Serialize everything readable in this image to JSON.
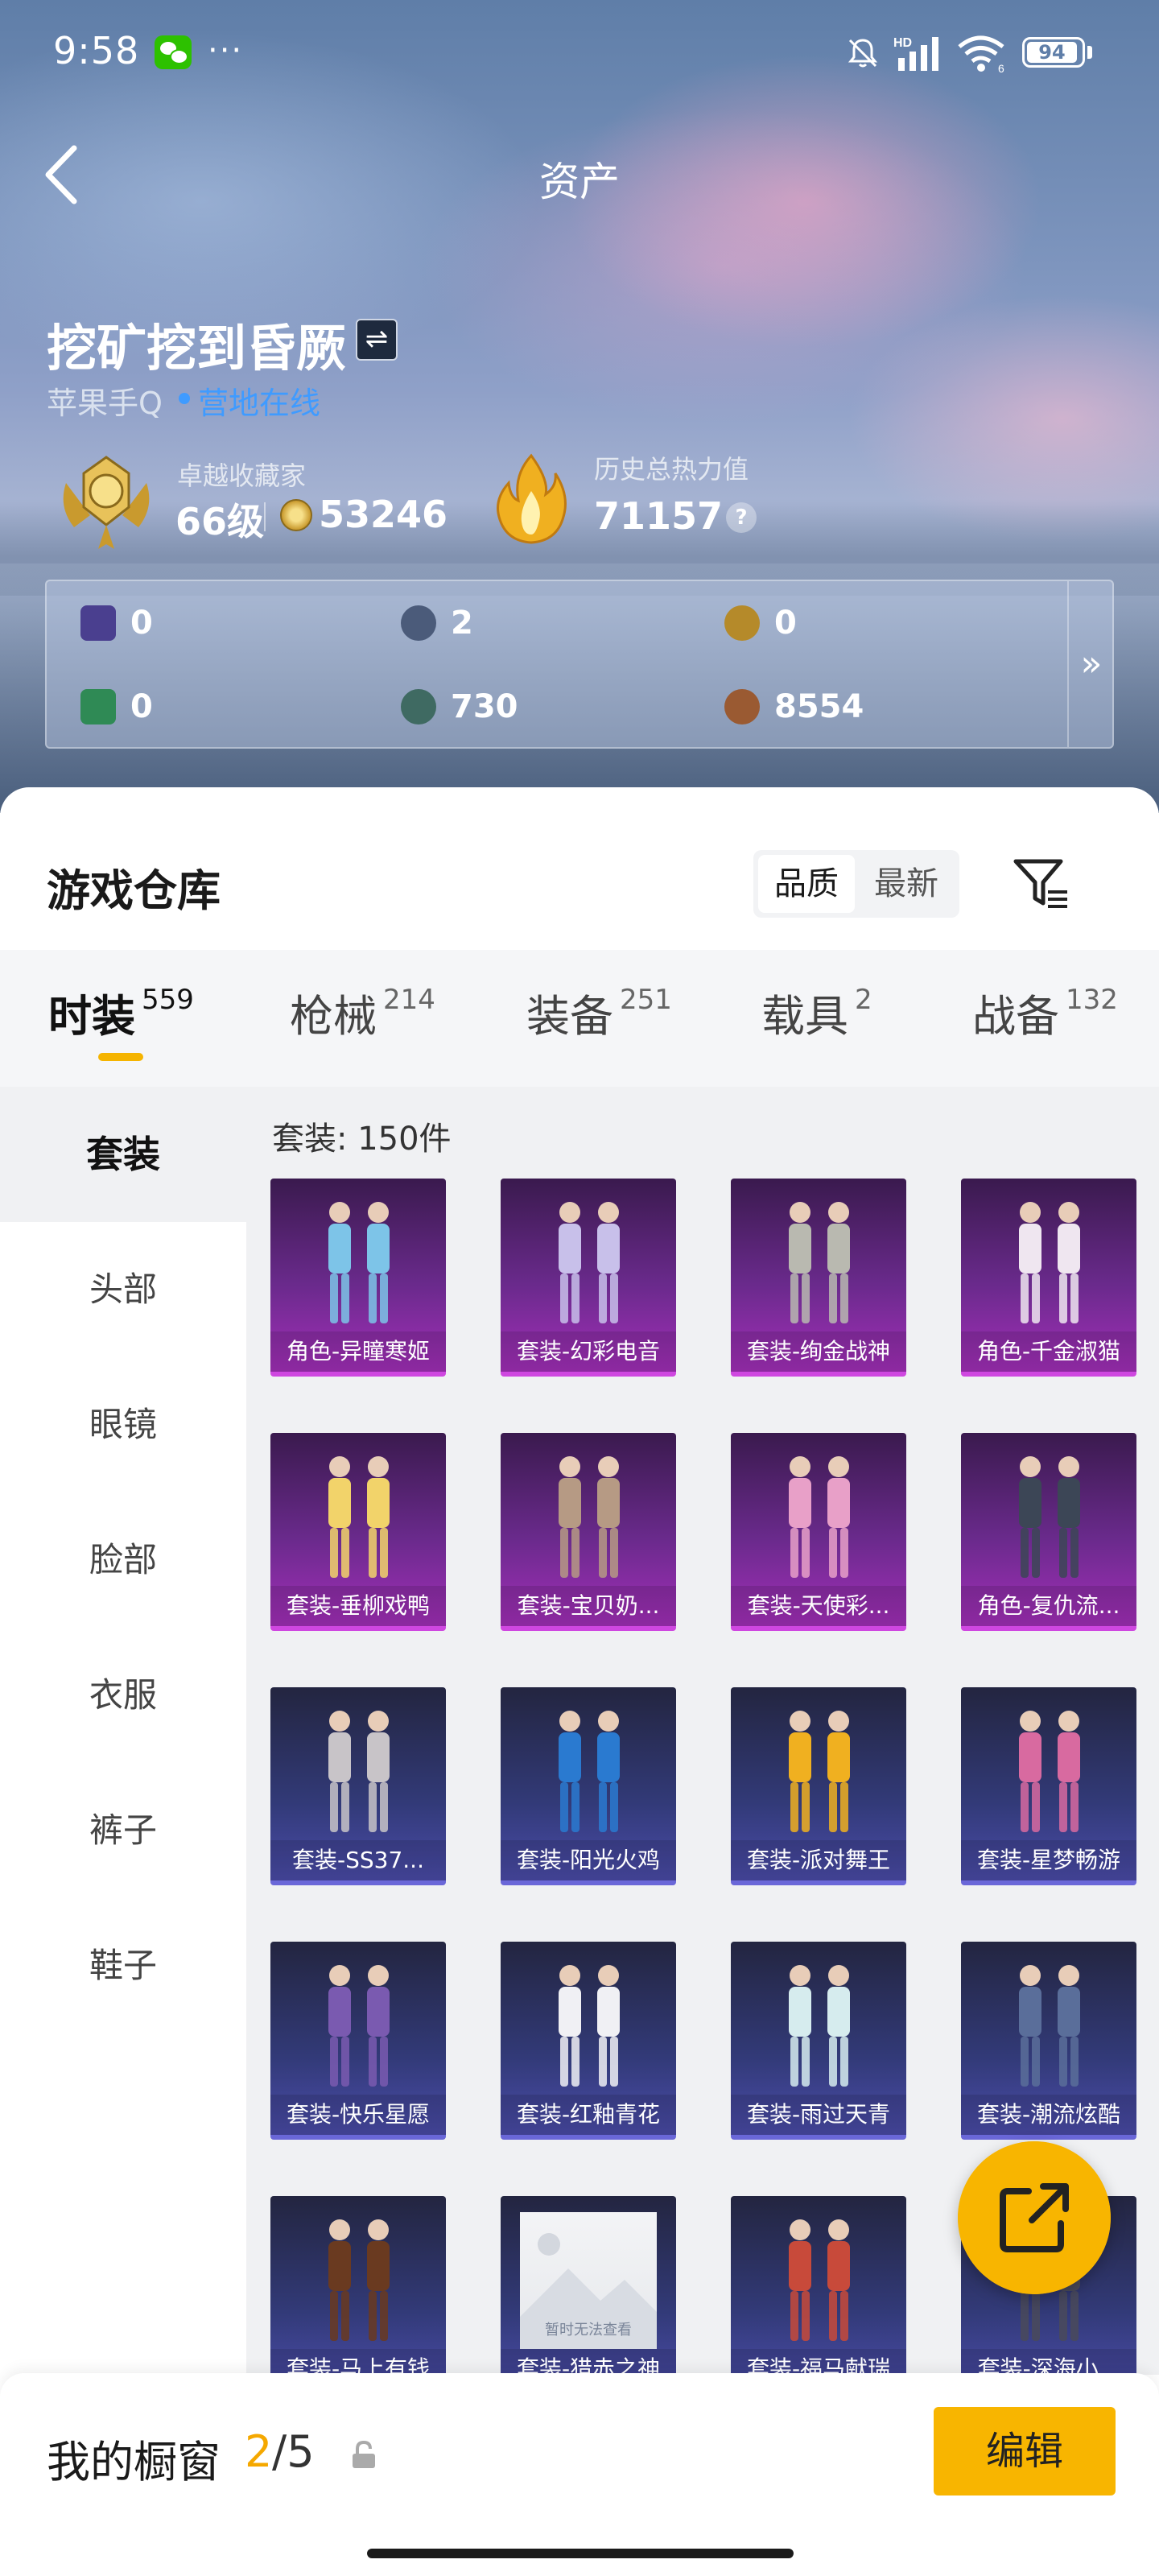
{
  "status_bar": {
    "time": "9:58",
    "more": "···",
    "battery": "94"
  },
  "nav": {
    "title": "资产"
  },
  "profile": {
    "username": "挖矿挖到昏厥",
    "switch_symbol": "⇌",
    "platform": "苹果手Q",
    "online_status": "营地在线",
    "collector_label": "卓越收藏家",
    "collector_level": "66级",
    "collector_points": "53246",
    "heat_label": "历史总热力值",
    "heat_value": "71157",
    "help_symbol": "?"
  },
  "currency_panel": {
    "items": [
      {
        "icon": "card-book-icon",
        "value": "0",
        "color": "#4a3f8f"
      },
      {
        "icon": "silver-coin-icon",
        "value": "2",
        "color": "#4b5b7a"
      },
      {
        "icon": "gold-token-icon",
        "value": "0",
        "color": "#b58a2a"
      },
      {
        "icon": "green-ticket-icon",
        "value": "0",
        "color": "#2f8a55"
      },
      {
        "icon": "teal-coin-icon",
        "value": "730",
        "color": "#3f6a62"
      },
      {
        "icon": "bronze-coin-icon",
        "value": "8554",
        "color": "#9a5a32"
      }
    ],
    "more_symbol": "»"
  },
  "warehouse": {
    "title": "游戏仓库",
    "sort_options": [
      "品质",
      "最新"
    ],
    "active_sort": "品质"
  },
  "tabs": [
    {
      "label": "时装",
      "count": "559",
      "active": true
    },
    {
      "label": "枪械",
      "count": "214",
      "active": false
    },
    {
      "label": "装备",
      "count": "251",
      "active": false
    },
    {
      "label": "载具",
      "count": "2",
      "active": false
    },
    {
      "label": "战备",
      "count": "132",
      "active": false
    }
  ],
  "sidebar": {
    "items": [
      "套装",
      "头部",
      "眼镜",
      "脸部",
      "衣服",
      "裤子",
      "鞋子"
    ],
    "active": "套装"
  },
  "content": {
    "count_label": "套装: 150件",
    "items": [
      {
        "caption": "角色-异瞳寒姬",
        "rarity": "purple"
      },
      {
        "caption": "套装-幻彩电音",
        "rarity": "purple"
      },
      {
        "caption": "套装-绚金战神",
        "rarity": "purple"
      },
      {
        "caption": "角色-千金淑猫",
        "rarity": "purple"
      },
      {
        "caption": "套装-垂柳戏鸭",
        "rarity": "purple"
      },
      {
        "caption": "套装-宝贝奶...",
        "rarity": "purple"
      },
      {
        "caption": "套装-天使彩...",
        "rarity": "purple"
      },
      {
        "caption": "角色-复仇流...",
        "rarity": "purple"
      },
      {
        "caption": "套装-SS37...",
        "rarity": "blue"
      },
      {
        "caption": "套装-阳光火鸡",
        "rarity": "blue"
      },
      {
        "caption": "套装-派对舞王",
        "rarity": "blue"
      },
      {
        "caption": "套装-星梦畅游",
        "rarity": "blue"
      },
      {
        "caption": "套装-快乐星愿",
        "rarity": "blue"
      },
      {
        "caption": "套装-红釉青花",
        "rarity": "blue"
      },
      {
        "caption": "套装-雨过天青",
        "rarity": "blue"
      },
      {
        "caption": "套装-潮流炫酷",
        "rarity": "blue"
      },
      {
        "caption": "套装-马上有钱",
        "rarity": "blue"
      },
      {
        "caption": "套装-猎赤之神",
        "rarity": "blue",
        "placeholder": "暂时无法查看"
      },
      {
        "caption": "套装-福马献瑞",
        "rarity": "blue"
      },
      {
        "caption": "套装-深海小...",
        "rarity": "blue"
      }
    ]
  },
  "bottom_bar": {
    "showcase_label": "我的橱窗",
    "showcase_count": "2",
    "showcase_total": "/5",
    "edit_label": "编辑"
  },
  "colors": {
    "accent": "#f8b500",
    "online": "#3f9bff",
    "purple_rarity": "#cf47e0",
    "blue_rarity": "#6a67d8"
  }
}
